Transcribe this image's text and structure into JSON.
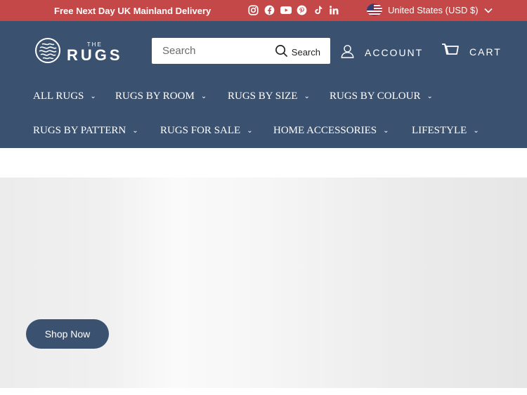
{
  "topbar": {
    "promo": "Free Next Day UK Mainland Delivery",
    "social_icons": [
      "instagram-icon",
      "facebook-icon",
      "youtube-icon",
      "pinterest-icon",
      "tiktok-icon",
      "linkedin-icon"
    ],
    "currency": "United States (USD $)",
    "background": "#c44848"
  },
  "header": {
    "background": "#3b5170",
    "logo": {
      "small": "THE",
      "main": "RUGS"
    },
    "search": {
      "placeholder": "Search",
      "button_label": "Search"
    },
    "account_label": "ACCOUNT",
    "cart_label": "CART"
  },
  "nav": {
    "row1": [
      "ALL RUGS",
      "RUGS BY ROOM",
      "RUGS BY SIZE",
      "RUGS BY COLOUR"
    ],
    "row2": [
      "RUGS BY PATTERN",
      "RUGS FOR SALE",
      "HOME ACCESSORIES",
      "LIFESTYLE"
    ]
  },
  "hero": {
    "cta_label": "Shop Now"
  }
}
